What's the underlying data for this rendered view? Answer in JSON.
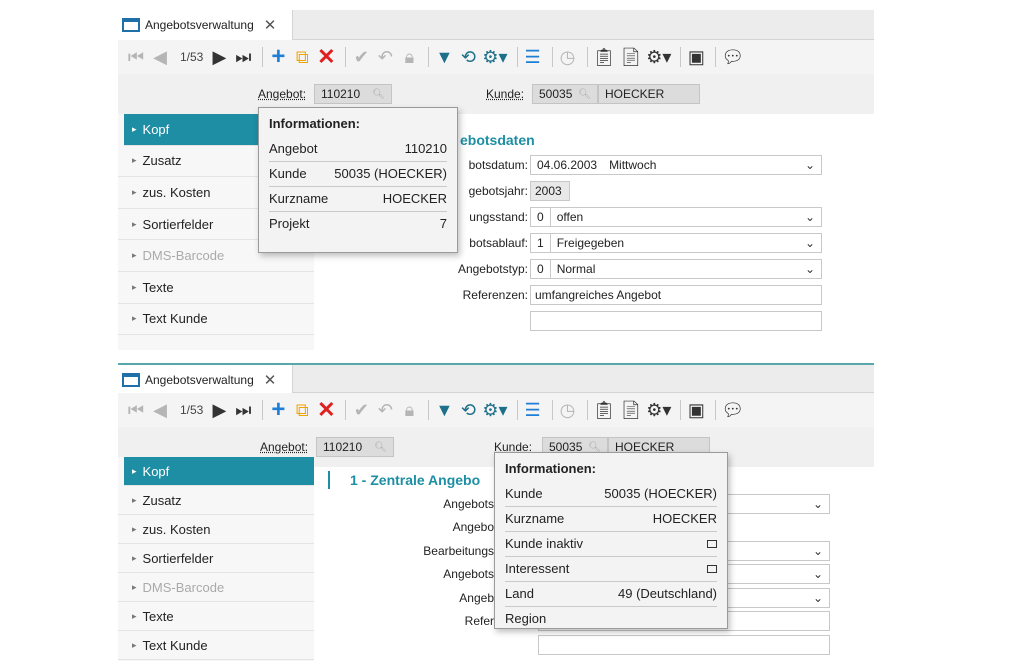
{
  "top": {
    "tab_title": "Angebotsverwaltung",
    "toolbar": {
      "pager": "1/53"
    },
    "idbar": {
      "angebot_label": "Angebot:",
      "angebot_value": "110210",
      "kunde_label": "Kunde:",
      "kunde_value": "50035",
      "kunde_name": "HOECKER"
    },
    "sidebar": [
      "Kopf",
      "Zusatz",
      "zus. Kosten",
      "Sortierfelder",
      "DMS-Barcode",
      "Texte",
      "Text Kunde"
    ],
    "section_title": "ebotsdaten",
    "form": {
      "datum_label": "botsdatum:",
      "datum_value": "04.06.2003",
      "datum_day": "Mittwoch",
      "jahr_label": "gebotsjahr:",
      "jahr_value": "2003",
      "stand_label": "ungsstand:",
      "stand_code": "0",
      "stand_value": "offen",
      "ablauf_label": "botsablauf:",
      "ablauf_code": "1",
      "ablauf_value": "Freigegeben",
      "typ_label": "Angebotstyp:",
      "typ_code": "0",
      "typ_value": "Normal",
      "ref_label": "Referenzen:",
      "ref_value": "umfangreiches Angebot"
    },
    "popup": {
      "title": "Informationen:",
      "rows": [
        {
          "label": "Angebot",
          "value": "110210"
        },
        {
          "label": "Kunde",
          "value": "50035 (HOECKER)"
        },
        {
          "label": "Kurzname",
          "value": "HOECKER"
        },
        {
          "label": "Projekt",
          "value": "7"
        }
      ]
    }
  },
  "bottom": {
    "tab_title": "Angebotsverwaltung",
    "toolbar": {
      "pager": "1/53"
    },
    "idbar": {
      "angebot_label": "Angebot:",
      "angebot_value": "110210",
      "kunde_label": "Kunde:",
      "kunde_value": "50035",
      "kunde_name": "HOECKER"
    },
    "sidebar": [
      "Kopf",
      "Zusatz",
      "zus. Kosten",
      "Sortierfelder",
      "DMS-Barcode",
      "Texte",
      "Text Kunde"
    ],
    "section_title": "1 - Zentrale Angebo",
    "form_labels": [
      "Angebots",
      "Angebo",
      "Bearbeitungs",
      "Angebots",
      "Angeb",
      "Refer"
    ],
    "popup": {
      "title": "Informationen:",
      "rows": [
        {
          "label": "Kunde",
          "value": "50035 (HOECKER)"
        },
        {
          "label": "Kurzname",
          "value": "HOECKER"
        },
        {
          "label": "Kunde inaktiv",
          "checkbox": true
        },
        {
          "label": "Interessent",
          "checkbox": true
        },
        {
          "label": "Land",
          "value": "49 (Deutschland)"
        },
        {
          "label": "Region",
          "value": ""
        }
      ]
    }
  }
}
